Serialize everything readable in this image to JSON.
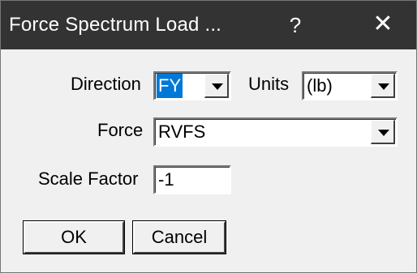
{
  "window": {
    "title": "Force Spectrum Load ...",
    "help_glyph": "?",
    "close_glyph": "✕"
  },
  "form": {
    "direction_label": "Direction",
    "direction_value": "FY",
    "units_label": "Units",
    "units_value": "(lb)",
    "force_label": "Force",
    "force_value": "RVFS",
    "scale_label": "Scale Factor",
    "scale_value": "-1"
  },
  "buttons": {
    "ok_label": "OK",
    "cancel_label": "Cancel"
  },
  "colors": {
    "titlebar": "#333333",
    "selection": "#0078d7",
    "dialog_bg": "#f0f0f0"
  }
}
